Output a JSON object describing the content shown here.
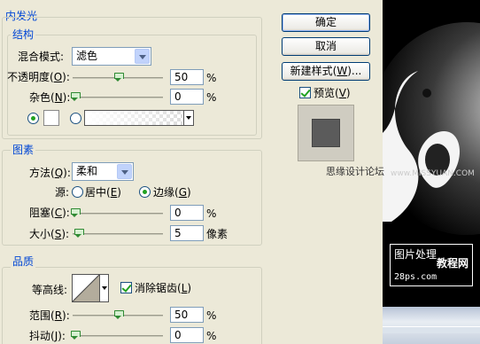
{
  "dialog": {
    "title": "内发光",
    "structure": {
      "legend": "结构",
      "blend_mode_label": "混合模式:",
      "blend_mode_value": "滤色",
      "opacity_label": "不透明度(O):",
      "opacity_value": "50",
      "opacity_unit": "%",
      "opacity_fraction": 0.5,
      "noise_label": "杂色(N):",
      "noise_value": "0",
      "noise_unit": "%",
      "noise_fraction": 0.0,
      "color_swatch": "#ffffff"
    },
    "elements": {
      "legend": "图素",
      "method_label": "方法(Q):",
      "method_value": "柔和",
      "source_label": "源:",
      "source_center": "居中(E)",
      "source_edge": "边缘(G)",
      "source_selected": "edge",
      "choke_label": "阻塞(C):",
      "choke_value": "0",
      "choke_unit": "%",
      "choke_fraction": 0.0,
      "size_label": "大小(S):",
      "size_value": "5",
      "size_unit": "像素",
      "size_fraction": 0.02
    },
    "quality": {
      "legend": "品质",
      "contour_label": "等高线:",
      "antialias_label": "消除锯齿(L)",
      "antialias_checked": true,
      "range_label": "范围(R):",
      "range_value": "50",
      "range_unit": "%",
      "range_fraction": 0.5,
      "jitter_label": "抖动(J):",
      "jitter_value": "0",
      "jitter_unit": "%",
      "jitter_fraction": 0.0
    }
  },
  "buttons": {
    "ok": "确定",
    "cancel": "取消",
    "new_style": "新建样式(W)...",
    "preview_label": "预览(V)",
    "preview_checked": true
  },
  "watermark": {
    "forum_text": "思缘设计论坛",
    "site": "www.MISSYUAN.COM",
    "badge_line1": "图片处理",
    "badge_line2": "教程网",
    "badge_line3": "28ps.com"
  },
  "colors": {
    "accent": "#0046d5",
    "dialog_bg": "#ece9d8",
    "canvas_bg": "#000000"
  }
}
